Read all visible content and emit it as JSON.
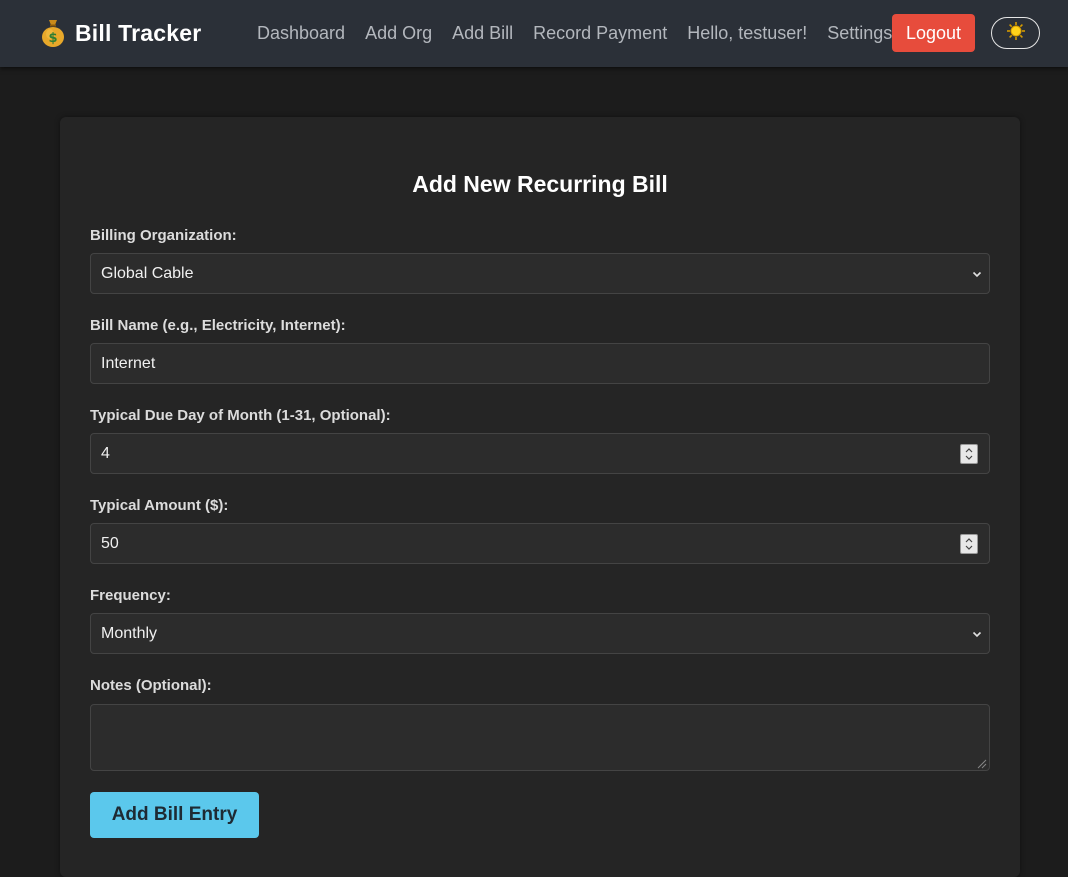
{
  "app": {
    "title": "Bill Tracker",
    "logo_icon": "money-bag-icon"
  },
  "nav": {
    "links": [
      "Dashboard",
      "Add Org",
      "Add Bill",
      "Record Payment"
    ],
    "greeting": "Hello, testuser!",
    "settings": "Settings",
    "logout": "Logout",
    "theme_icon": "sun-icon"
  },
  "form": {
    "title": "Add New Recurring Bill",
    "org_label": "Billing Organization:",
    "org_value": "Global Cable",
    "name_label": "Bill Name (e.g., Electricity, Internet):",
    "name_value": "Internet",
    "due_label": "Typical Due Day of Month (1-31, Optional):",
    "due_value": "4",
    "amount_label": "Typical Amount ($):",
    "amount_value": "50",
    "freq_label": "Frequency:",
    "freq_value": "Monthly",
    "notes_label": "Notes (Optional):",
    "notes_value": "",
    "submit": "Add Bill Entry"
  },
  "colors": {
    "navbar": "#2b3038",
    "background": "#1c1c1c",
    "card": "#252525",
    "logout": "#e74c3c",
    "submit": "#5bc8ec"
  }
}
